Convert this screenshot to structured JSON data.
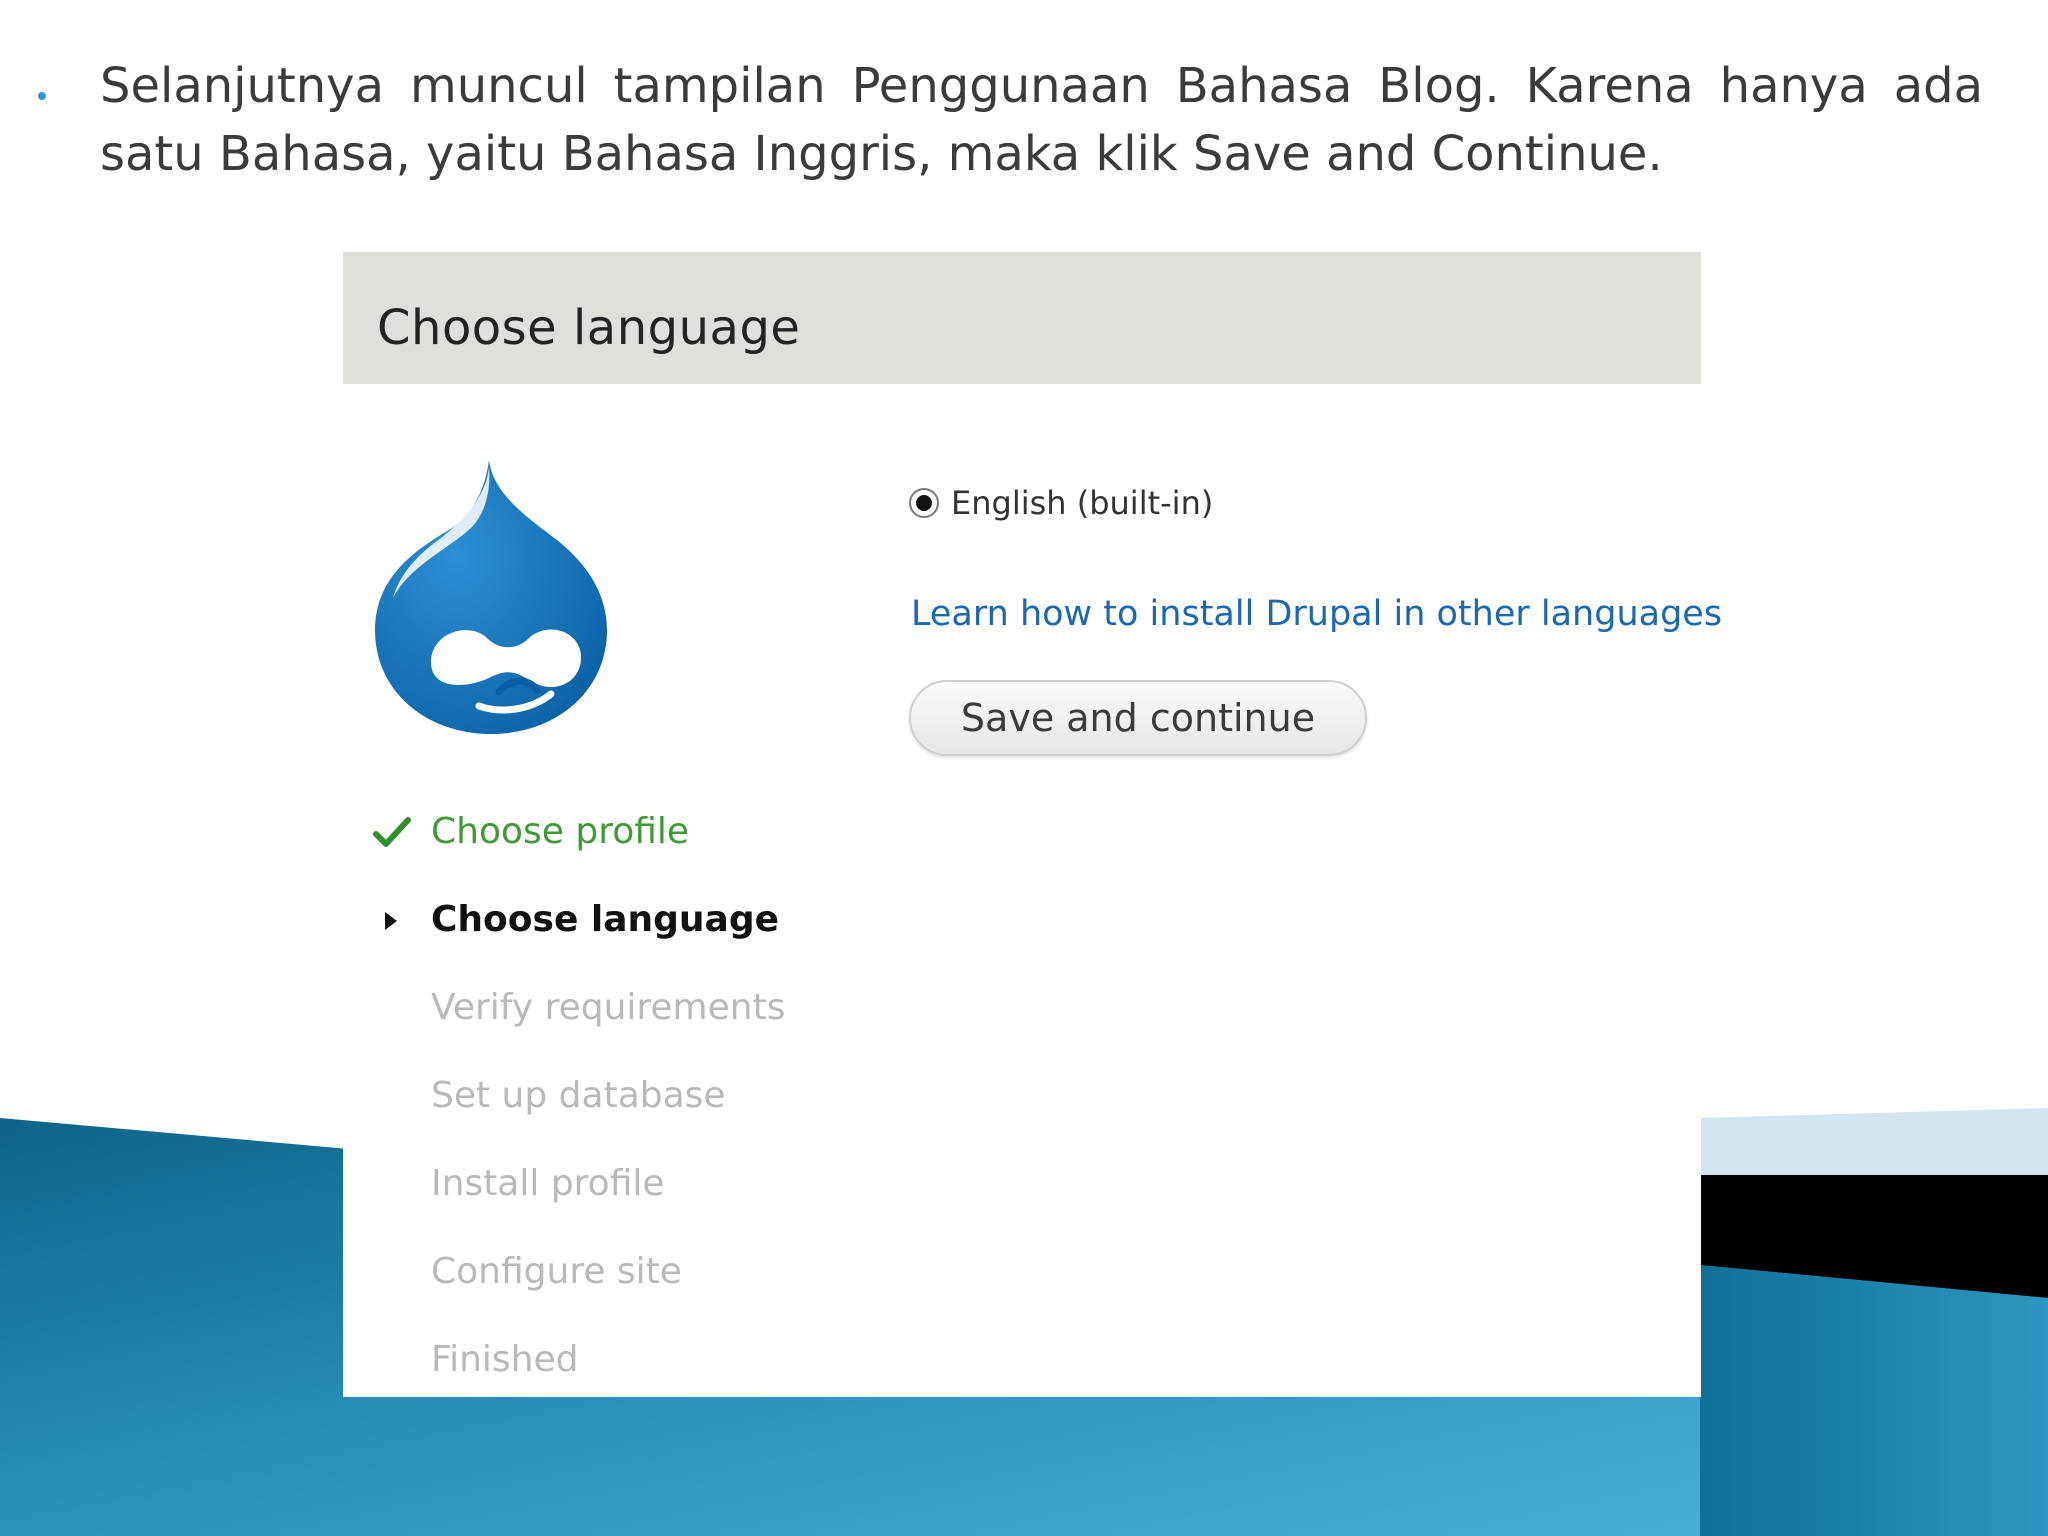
{
  "slide": {
    "bullet_text": "Selanjutnya muncul tampilan Penggunaan Bahasa Blog. Karena hanya ada satu Bahasa, yaitu Bahasa Inggris, maka klik Save and Continue."
  },
  "installer": {
    "title": "Choose language",
    "language_options": [
      {
        "label": "English (built-in)",
        "selected": true
      }
    ],
    "learn_link": "Learn how to install Drupal in other languages",
    "save_button": "Save and continue",
    "steps": [
      {
        "label": "Choose profile",
        "status": "done"
      },
      {
        "label": "Choose language",
        "status": "active"
      },
      {
        "label": "Verify requirements",
        "status": "pending"
      },
      {
        "label": "Set up database",
        "status": "pending"
      },
      {
        "label": "Install profile",
        "status": "pending"
      },
      {
        "label": "Configure site",
        "status": "pending"
      },
      {
        "label": "Finished",
        "status": "pending"
      }
    ]
  },
  "colors": {
    "header_bg": "#e1dfdb",
    "link": "#1a68b0",
    "done_step": "#3d9a35",
    "drupal_blue": "#0f6cb5",
    "slide_teal": "#1b7fa6"
  },
  "icons": {
    "logo": "drupal-drop-logo",
    "done_step": "checkmark-icon",
    "active_step": "triangle-right-icon"
  }
}
